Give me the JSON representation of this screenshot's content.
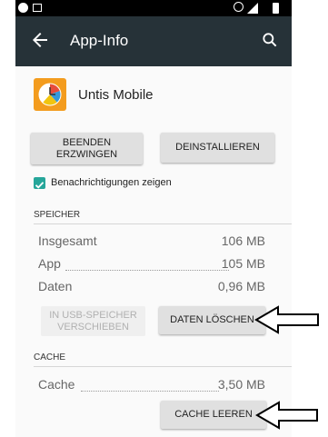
{
  "appbar": {
    "title": "App-Info"
  },
  "app": {
    "name": "Untis Mobile",
    "icon": "clock-icon"
  },
  "buttons": {
    "force_stop": "BEENDEN ERZWINGEN",
    "uninstall": "DEINSTALLIEREN",
    "move_usb": "IN USB-SPEICHER VERSCHIEBEN",
    "clear_data": "DATEN LÖSCHEN",
    "clear_cache": "CACHE LEEREN"
  },
  "notifications": {
    "label": "Benachrichtigungen zeigen",
    "checked": true
  },
  "storage": {
    "header": "SPEICHER",
    "rows": [
      {
        "label": "Insgesamt",
        "value": "106 MB"
      },
      {
        "label": "App",
        "value": "105 MB"
      },
      {
        "label": "Daten",
        "value": "0,96 MB"
      }
    ]
  },
  "cache": {
    "header": "CACHE",
    "rows": [
      {
        "label": "Cache",
        "value": "3,50 MB"
      }
    ]
  },
  "colors": {
    "appbar": "#263238",
    "accent": "#26a69a",
    "app_icon": "#f39c1e"
  },
  "icons": [
    "back-arrow-icon",
    "search-icon",
    "checkbox-checked-icon",
    "clock-icon",
    "pointer-arrow-icon"
  ]
}
